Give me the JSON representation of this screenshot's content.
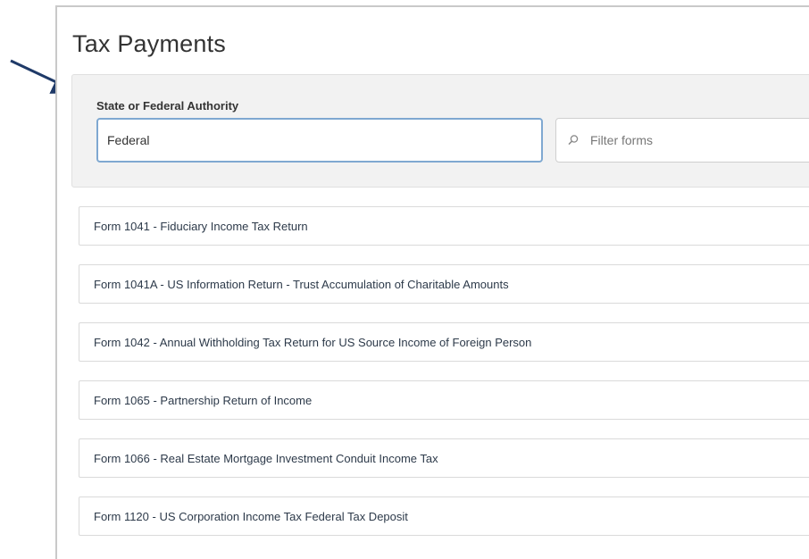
{
  "page": {
    "title": "Tax Payments"
  },
  "filters": {
    "authority_label": "State or Federal Authority",
    "authority_value": "Federal",
    "search_placeholder": "Filter forms",
    "search_value": ""
  },
  "forms": [
    {
      "label": "Form 1041 - Fiduciary Income Tax Return"
    },
    {
      "label": "Form 1041A - US Information Return - Trust Accumulation of Charitable Amounts"
    },
    {
      "label": "Form 1042 - Annual Withholding Tax Return for US Source Income of Foreign Person"
    },
    {
      "label": "Form 1065 - Partnership Return of Income"
    },
    {
      "label": "Form 1066 - Real Estate Mortgage Investment Conduit Income Tax"
    },
    {
      "label": "Form 1120 - US Corporation Income Tax Federal Tax Deposit"
    }
  ],
  "icons": {
    "annotation": "arrow-pointer-icon",
    "search": "search-icon"
  },
  "colors": {
    "arrow": "#1f3a68",
    "focus_border": "#7fa8d1",
    "filter_area_bg": "#f2f2f2",
    "item_text": "#2d3a4a"
  }
}
